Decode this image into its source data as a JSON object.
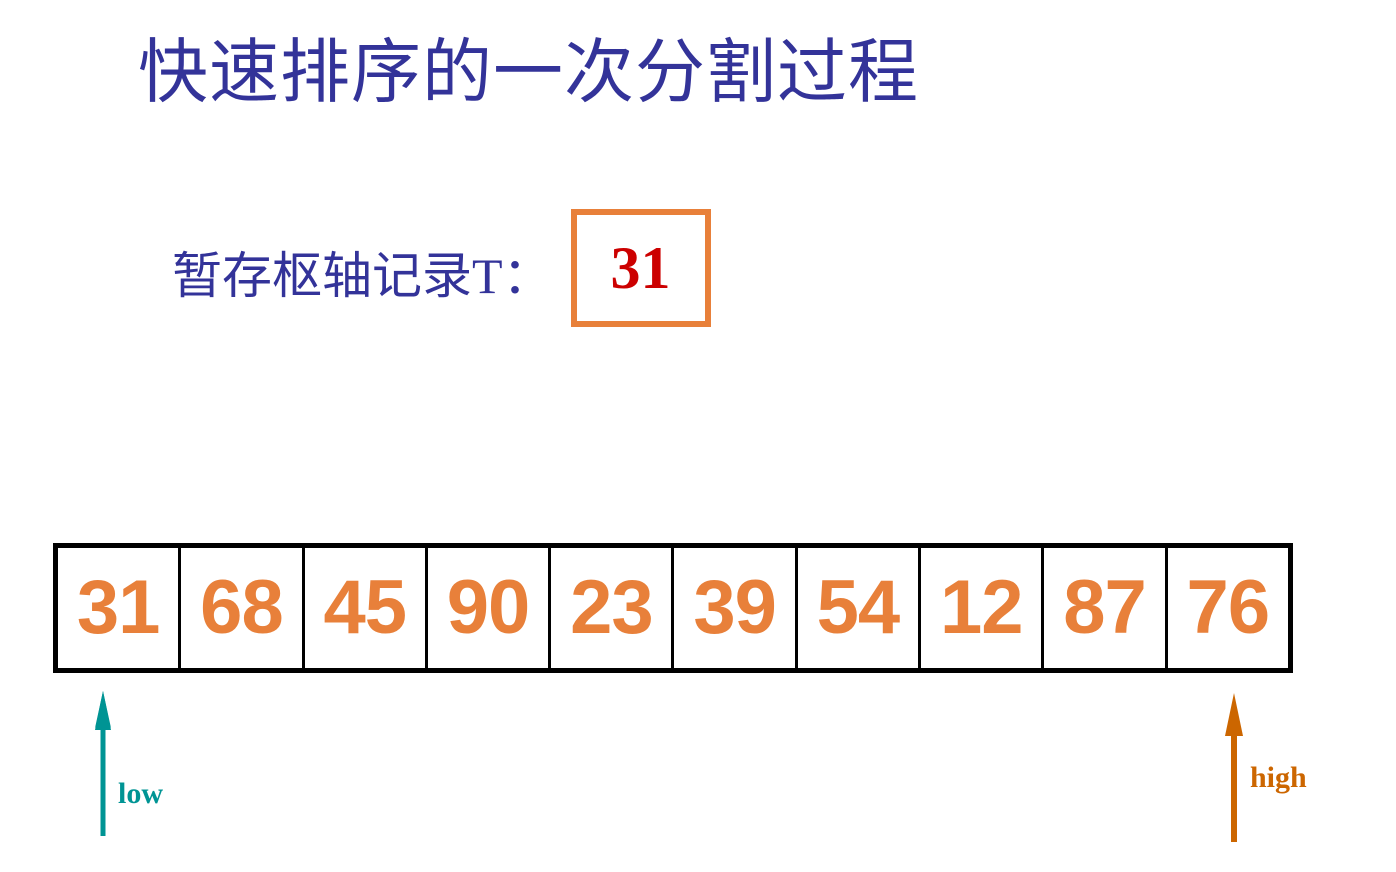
{
  "slide": {
    "title": "快速排序的一次分割过程",
    "title_color": "#333399",
    "background": "#ffffff"
  },
  "pivot": {
    "label": "暂存枢轴记录T：",
    "label_color": "#333399",
    "value": "31",
    "value_color": "#CC0000",
    "box_border_color": "#E8803A"
  },
  "array": {
    "border_color": "#000000",
    "value_color": "#E8803A",
    "cells": [
      {
        "index": 0,
        "value": "31"
      },
      {
        "index": 1,
        "value": "68"
      },
      {
        "index": 2,
        "value": "45"
      },
      {
        "index": 3,
        "value": "90"
      },
      {
        "index": 4,
        "value": "23"
      },
      {
        "index": 5,
        "value": "39"
      },
      {
        "index": 6,
        "value": "54"
      },
      {
        "index": 7,
        "value": "12"
      },
      {
        "index": 8,
        "value": "87"
      },
      {
        "index": 9,
        "value": "76"
      }
    ]
  },
  "pointers": {
    "low": {
      "label": "low",
      "color": "#009494",
      "points_to_index": 0
    },
    "high": {
      "label": "high",
      "color": "#CC6600",
      "points_to_index": 9
    }
  },
  "chart_data": {
    "type": "table",
    "title": "快速排序的一次分割过程",
    "categories": [
      "0",
      "1",
      "2",
      "3",
      "4",
      "5",
      "6",
      "7",
      "8",
      "9"
    ],
    "values": [
      31,
      68,
      45,
      90,
      23,
      39,
      54,
      12,
      87,
      76
    ],
    "annotations": [
      {
        "name": "pivot",
        "label": "暂存枢轴记录T：",
        "value": 31
      },
      {
        "name": "low",
        "label": "low",
        "index": 0
      },
      {
        "name": "high",
        "label": "high",
        "index": 9
      }
    ],
    "xlabel": "",
    "ylabel": ""
  }
}
